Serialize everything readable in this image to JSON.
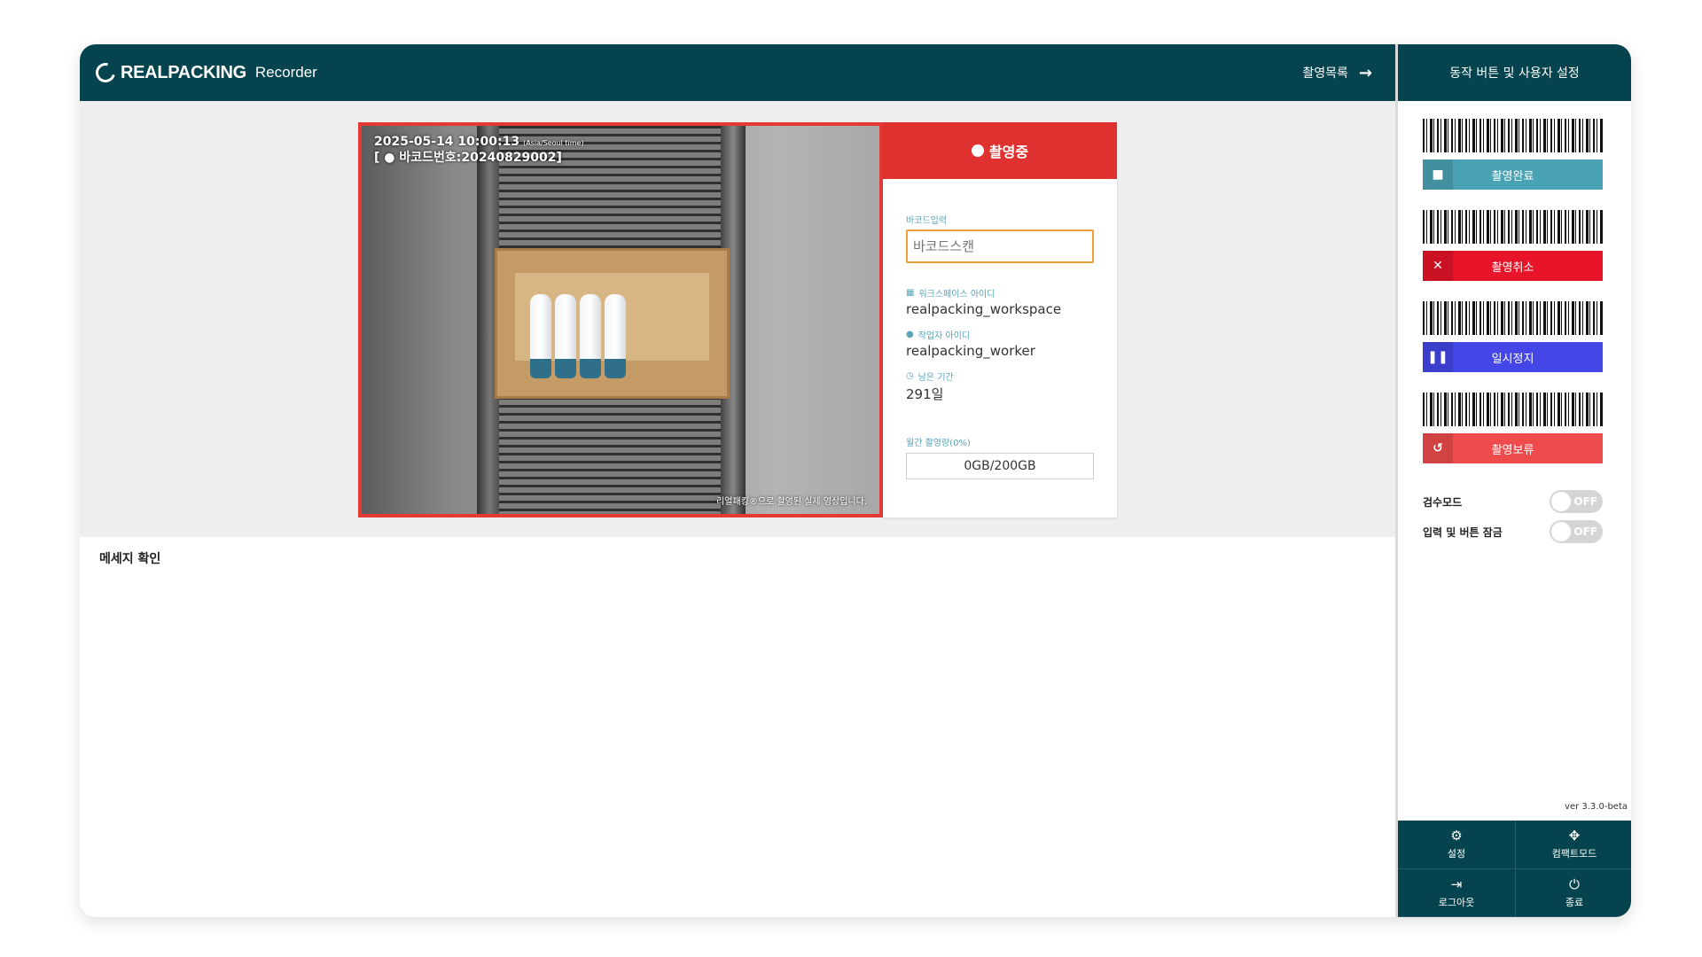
{
  "header": {
    "brand": "REALPACKING",
    "product": "Recorder",
    "list_link": "촬영목록",
    "list_arrow": "→"
  },
  "video": {
    "timestamp": "2025-05-14 10:00:13",
    "timezone": "(Asia/Seoul time)",
    "barcode_line": "[ ● 바코드번호:20240829002]",
    "caption": "리얼패킹®으로 촬영된 실제 영상입니다."
  },
  "panel": {
    "status": "촬영중",
    "barcode_label": "바코드입력",
    "barcode_placeholder": "바코드스캔",
    "workspace_label": "워크스페이스 아이디",
    "workspace_value": "realpacking_workspace",
    "worker_label": "작업자 아이디",
    "worker_value": "realpacking_worker",
    "remaining_label": "남은 기간",
    "remaining_value": "291일",
    "usage_label": "월간 촬영량(0%)",
    "usage_value": "0GB/200GB",
    "usage_percent": 0
  },
  "messages": {
    "title": "메세지 확인"
  },
  "sidebar": {
    "title": "동작 버튼 및 사용자 설정",
    "actions": [
      {
        "label": "촬영완료",
        "icon": "stop-icon",
        "glyph": "■",
        "color": "#4aa3b5"
      },
      {
        "label": "촬영취소",
        "icon": "close-icon",
        "glyph": "✕",
        "color": "#e8152a"
      },
      {
        "label": "일시정지",
        "icon": "pause-icon",
        "glyph": "❚❚",
        "color": "#4446e8"
      },
      {
        "label": "촬영보류",
        "icon": "history-icon",
        "glyph": "↺",
        "color": "#ee4c4c"
      }
    ],
    "toggles": [
      {
        "label": "검수모드",
        "state": "OFF"
      },
      {
        "label": "입력 및 버튼 잠금",
        "state": "OFF"
      }
    ],
    "version": "ver 3.3.0-beta",
    "footer": [
      {
        "label": "설정",
        "icon": "gear-icon",
        "glyph": "⚙"
      },
      {
        "label": "컴팩트모드",
        "icon": "compress-icon",
        "glyph": "✥"
      },
      {
        "label": "로그아웃",
        "icon": "logout-icon",
        "glyph": "⇥"
      },
      {
        "label": "종료",
        "icon": "power-icon",
        "glyph": "⏻"
      }
    ]
  }
}
